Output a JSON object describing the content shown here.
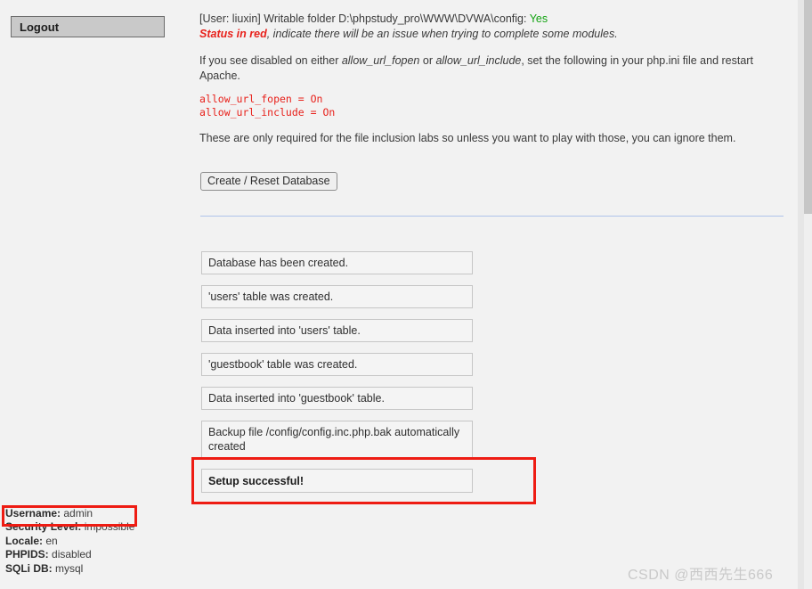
{
  "sidebar": {
    "logout_label": "Logout",
    "info": [
      {
        "key": "Username:",
        "value": "admin"
      },
      {
        "key": "Security Level:",
        "value": "impossible"
      },
      {
        "key": "Locale:",
        "value": "en"
      },
      {
        "key": "PHPIDS:",
        "value": "disabled"
      },
      {
        "key": "SQLi DB:",
        "value": "mysql"
      }
    ]
  },
  "main": {
    "status_line": {
      "prefix": "[User: liuxin] Writable folder D:\\phpstudy_pro\\WWW\\DVWA\\config: ",
      "status_value": "Yes"
    },
    "status_note": {
      "bold_red": "Status in red",
      "rest": ", indicate there will be an issue when trying to complete some modules."
    },
    "disabled_note": {
      "part1": "If you see disabled on either ",
      "em1": "allow_url_fopen",
      "part2": " or ",
      "em2": "allow_url_include",
      "part3": ", set the following in your php.ini file and restart Apache."
    },
    "code_lines": [
      "allow_url_fopen = On",
      "allow_url_include = On"
    ],
    "note": "These are only required for the file inclusion labs so unless you want to play with those, you can ignore them.",
    "reset_button_label": "Create / Reset Database",
    "messages": [
      {
        "text": "Database has been created.",
        "success": false,
        "two_line": false
      },
      {
        "text": "'users' table was created.",
        "success": false,
        "two_line": false
      },
      {
        "text": "Data inserted into 'users' table.",
        "success": false,
        "two_line": false
      },
      {
        "text": "'guestbook' table was created.",
        "success": false,
        "two_line": false
      },
      {
        "text": "Data inserted into 'guestbook' table.",
        "success": false,
        "two_line": false
      },
      {
        "text": "Backup file /config/config.inc.php.bak automatically created",
        "success": false,
        "two_line": true
      },
      {
        "text": "Setup successful!",
        "success": true,
        "two_line": false
      }
    ]
  },
  "watermark": "CSDN @西西先生666",
  "colors": {
    "accent_red": "#ee1c13",
    "status_ok_green": "#13a312",
    "code_red": "#e8211b",
    "divider_blue": "#aec4ea",
    "page_background": "#f2f2f2"
  }
}
